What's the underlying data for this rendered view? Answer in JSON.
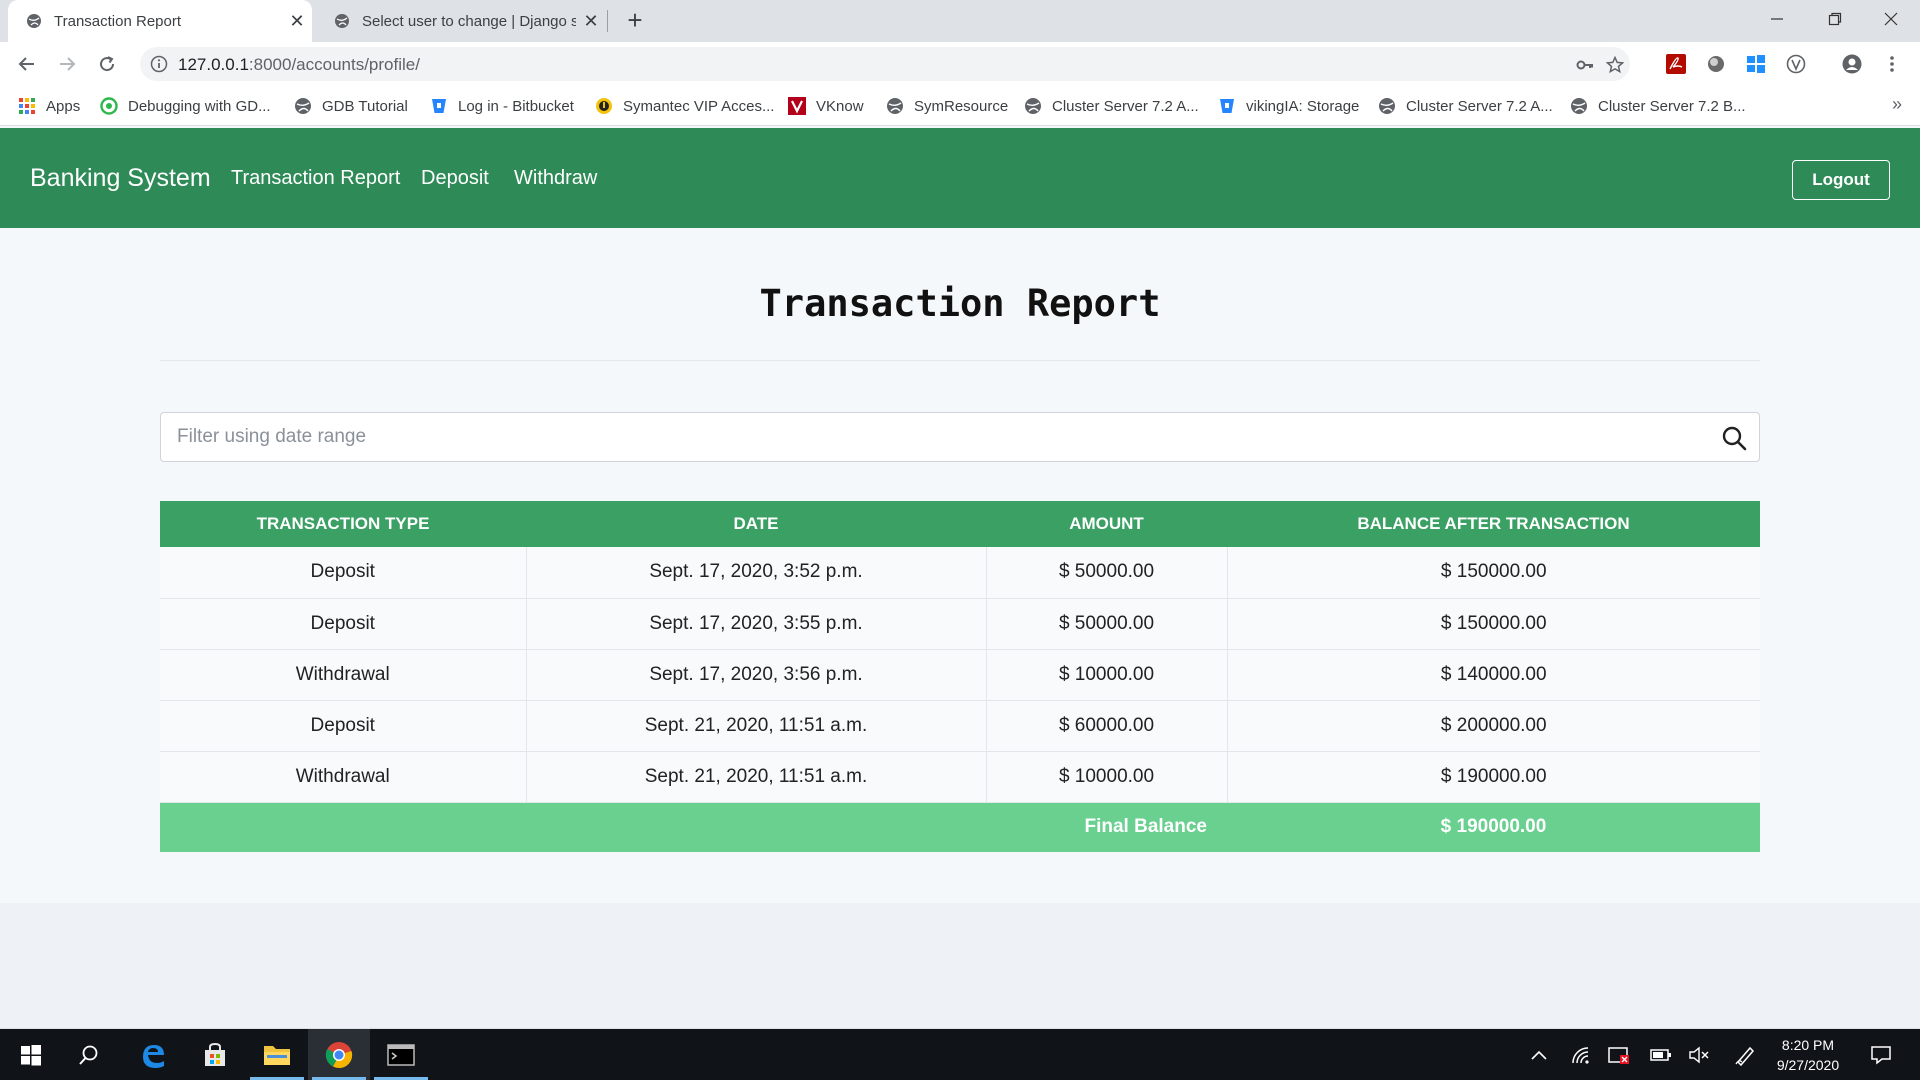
{
  "browser": {
    "tabs": [
      {
        "title": "Transaction Report",
        "active": true
      },
      {
        "title": "Select user to change | Django site admin",
        "active": false
      }
    ],
    "url_host": "127.0.0.1",
    "url_path": ":8000/accounts/profile/",
    "bookmarks": [
      {
        "label": "Apps",
        "icon": "apps-grid-icon"
      },
      {
        "label": "Debugging with GD...",
        "icon": "green-circle-icon"
      },
      {
        "label": "GDB Tutorial",
        "icon": "globe-icon"
      },
      {
        "label": "Log in - Bitbucket",
        "icon": "bitbucket-icon"
      },
      {
        "label": "Symantec VIP Acces...",
        "icon": "symantec-icon"
      },
      {
        "label": "VKnow",
        "icon": "vknow-icon"
      },
      {
        "label": "SymResource",
        "icon": "globe-icon"
      },
      {
        "label": "Cluster Server 7.2 A...",
        "icon": "globe-icon"
      },
      {
        "label": "vikingIA: Storage",
        "icon": "bitbucket-icon"
      },
      {
        "label": "Cluster Server 7.2 A...",
        "icon": "globe-icon"
      },
      {
        "label": "Cluster Server 7.2 B...",
        "icon": "globe-icon"
      }
    ],
    "bookmarks_overflow": "»"
  },
  "navbar": {
    "brand": "Banking System",
    "links": [
      "Transaction Report",
      "Deposit",
      "Withdraw"
    ],
    "logout": "Logout",
    "color": "#2e8b57"
  },
  "report": {
    "title": "Transaction Report",
    "filter_placeholder": "Filter using date range",
    "columns": [
      "TRANSACTION TYPE",
      "DATE",
      "AMOUNT",
      "BALANCE AFTER TRANSACTION"
    ],
    "rows": [
      {
        "type": "Deposit",
        "date": "Sept. 17, 2020, 3:52 p.m.",
        "amount": "$ 50000.00",
        "balance": "$ 150000.00"
      },
      {
        "type": "Deposit",
        "date": "Sept. 17, 2020, 3:55 p.m.",
        "amount": "$ 50000.00",
        "balance": "$ 150000.00"
      },
      {
        "type": "Withdrawal",
        "date": "Sept. 17, 2020, 3:56 p.m.",
        "amount": "$ 10000.00",
        "balance": "$ 140000.00"
      },
      {
        "type": "Deposit",
        "date": "Sept. 21, 2020, 11:51 a.m.",
        "amount": "$ 60000.00",
        "balance": "$ 200000.00"
      },
      {
        "type": "Withdrawal",
        "date": "Sept. 21, 2020, 11:51 a.m.",
        "amount": "$ 10000.00",
        "balance": "$ 190000.00"
      }
    ],
    "final_label": "Final Balance",
    "final_balance": "$ 190000.00",
    "header_color": "#3aa064",
    "footer_color": "#69d08f"
  },
  "taskbar": {
    "time": "8:20 PM",
    "date": "9/27/2020"
  }
}
